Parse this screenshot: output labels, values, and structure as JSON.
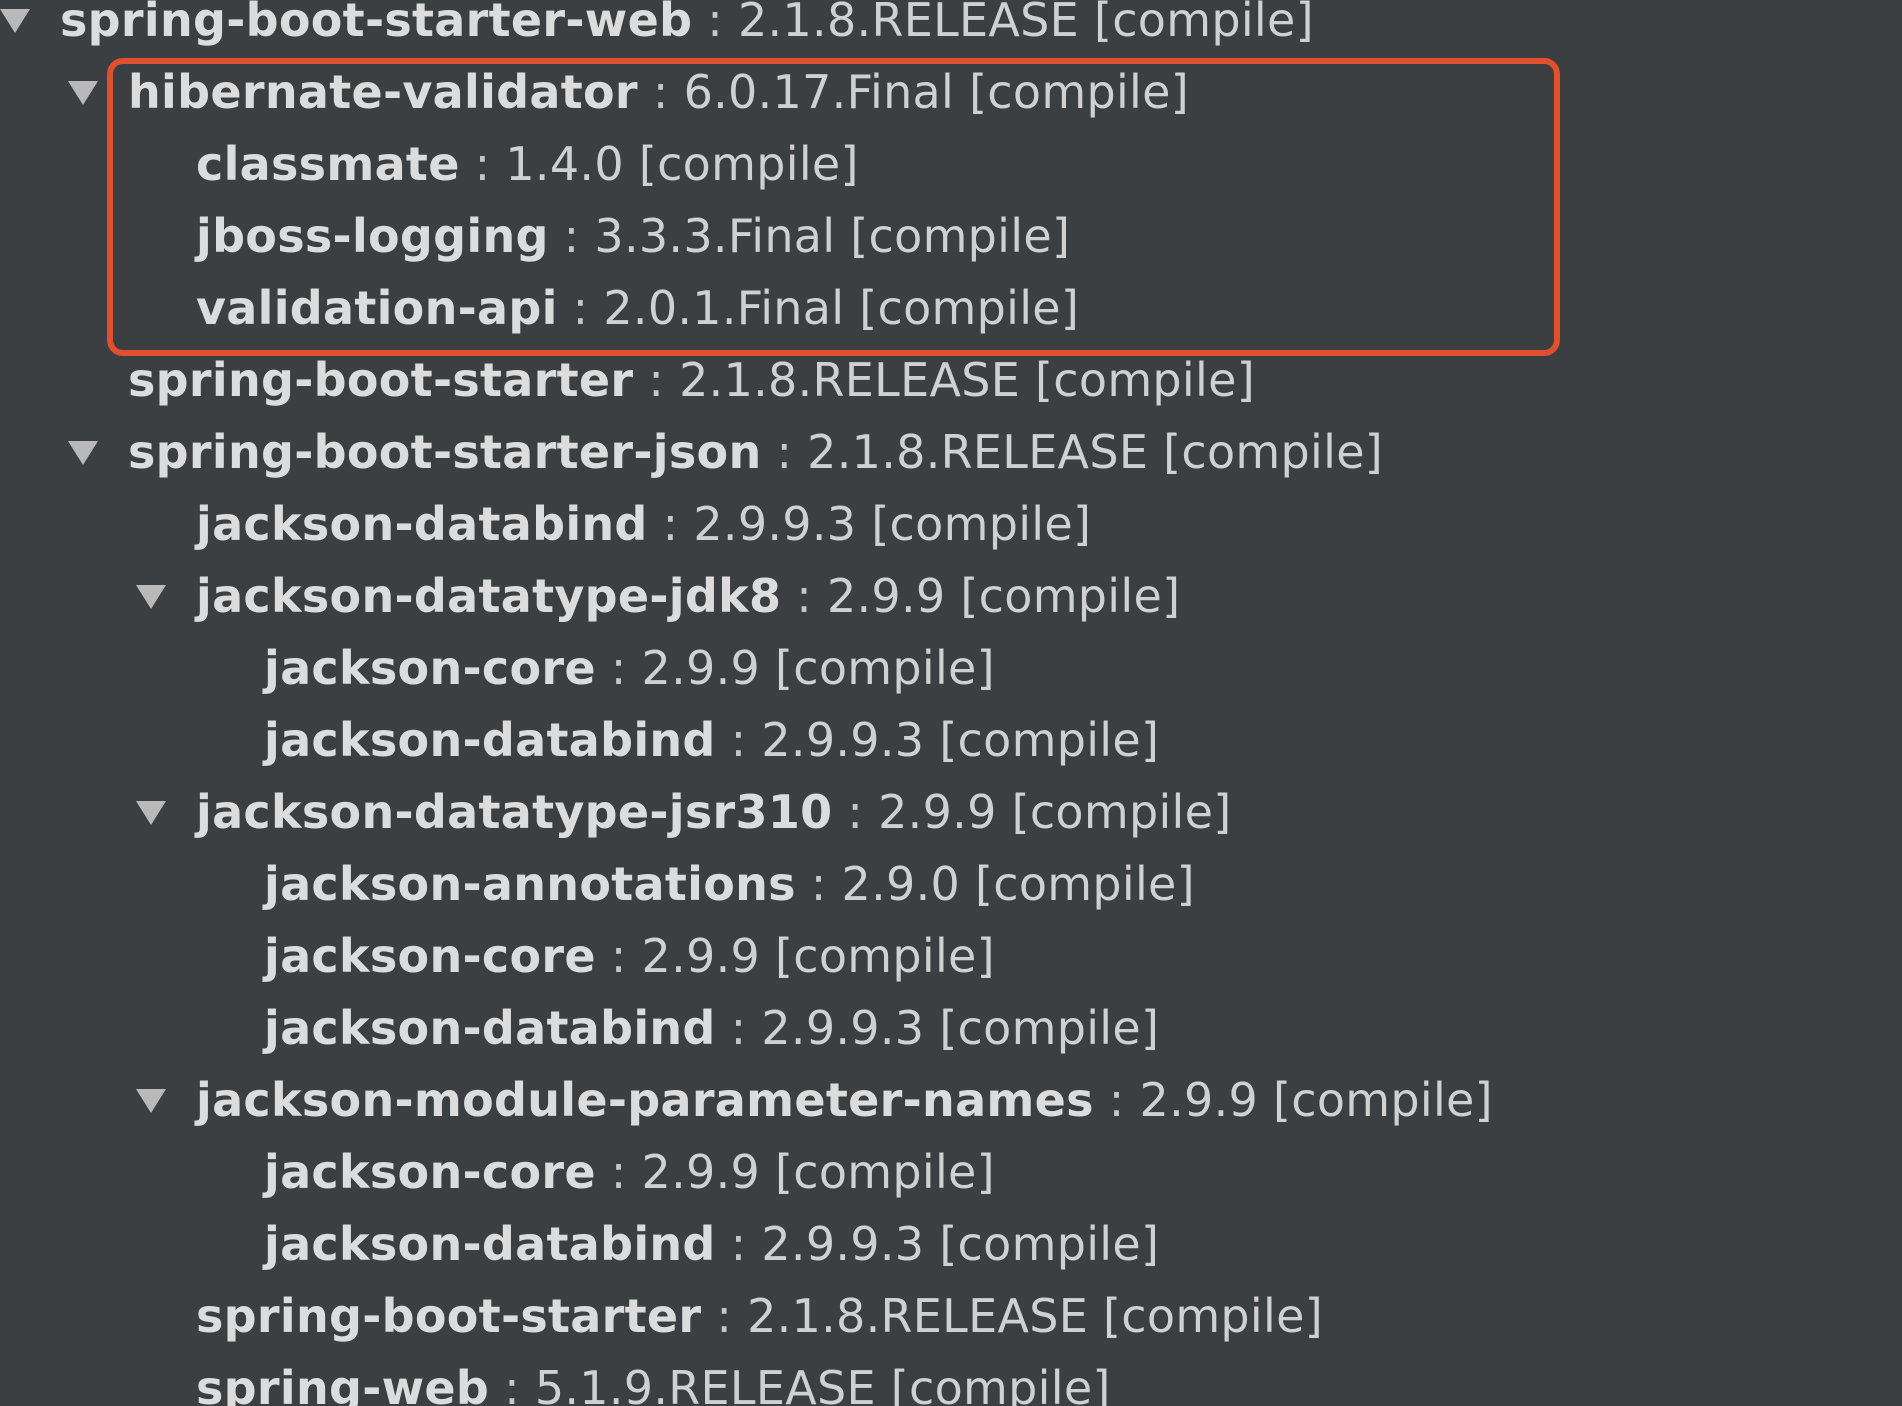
{
  "dependency_tree": {
    "colors": {
      "background": "#3c3f41",
      "text": "#d4d4d4",
      "highlight": "#e0502f"
    },
    "highlight_icon": "red-highlight-rectangle",
    "toggle_icon": "triangle-down-icon",
    "rows": [
      {
        "depth": 0,
        "expanded": true,
        "name": "spring-boot-starter-web",
        "version": "2.1.8.RELEASE",
        "scope": "[compile]"
      },
      {
        "depth": 1,
        "expanded": true,
        "name": "hibernate-validator",
        "version": "6.0.17.Final",
        "scope": "[compile]"
      },
      {
        "depth": 2,
        "expanded": false,
        "name": "classmate",
        "version": "1.4.0",
        "scope": "[compile]"
      },
      {
        "depth": 2,
        "expanded": false,
        "name": "jboss-logging",
        "version": "3.3.3.Final",
        "scope": "[compile]"
      },
      {
        "depth": 2,
        "expanded": false,
        "name": "validation-api",
        "version": "2.0.1.Final",
        "scope": "[compile]"
      },
      {
        "depth": 1,
        "expanded": false,
        "name": "spring-boot-starter",
        "version": "2.1.8.RELEASE",
        "scope": "[compile]"
      },
      {
        "depth": 1,
        "expanded": true,
        "name": "spring-boot-starter-json",
        "version": "2.1.8.RELEASE",
        "scope": "[compile]"
      },
      {
        "depth": 2,
        "expanded": false,
        "name": "jackson-databind",
        "version": "2.9.9.3",
        "scope": "[compile]"
      },
      {
        "depth": 2,
        "expanded": true,
        "name": "jackson-datatype-jdk8",
        "version": "2.9.9",
        "scope": "[compile]"
      },
      {
        "depth": 3,
        "expanded": false,
        "name": "jackson-core",
        "version": "2.9.9",
        "scope": "[compile]"
      },
      {
        "depth": 3,
        "expanded": false,
        "name": "jackson-databind",
        "version": "2.9.9.3",
        "scope": "[compile]"
      },
      {
        "depth": 2,
        "expanded": true,
        "name": "jackson-datatype-jsr310",
        "version": "2.9.9",
        "scope": "[compile]"
      },
      {
        "depth": 3,
        "expanded": false,
        "name": "jackson-annotations",
        "version": "2.9.0",
        "scope": "[compile]"
      },
      {
        "depth": 3,
        "expanded": false,
        "name": "jackson-core",
        "version": "2.9.9",
        "scope": "[compile]"
      },
      {
        "depth": 3,
        "expanded": false,
        "name": "jackson-databind",
        "version": "2.9.9.3",
        "scope": "[compile]"
      },
      {
        "depth": 2,
        "expanded": true,
        "name": "jackson-module-parameter-names",
        "version": "2.9.9",
        "scope": "[compile]"
      },
      {
        "depth": 3,
        "expanded": false,
        "name": "jackson-core",
        "version": "2.9.9",
        "scope": "[compile]"
      },
      {
        "depth": 3,
        "expanded": false,
        "name": "jackson-databind",
        "version": "2.9.9.3",
        "scope": "[compile]"
      },
      {
        "depth": 2,
        "expanded": false,
        "name": "spring-boot-starter",
        "version": "2.1.8.RELEASE",
        "scope": "[compile]"
      },
      {
        "depth": 2,
        "expanded": false,
        "name": "spring-web",
        "version": "5.1.9.RELEASE",
        "scope": "[compile]"
      }
    ]
  }
}
